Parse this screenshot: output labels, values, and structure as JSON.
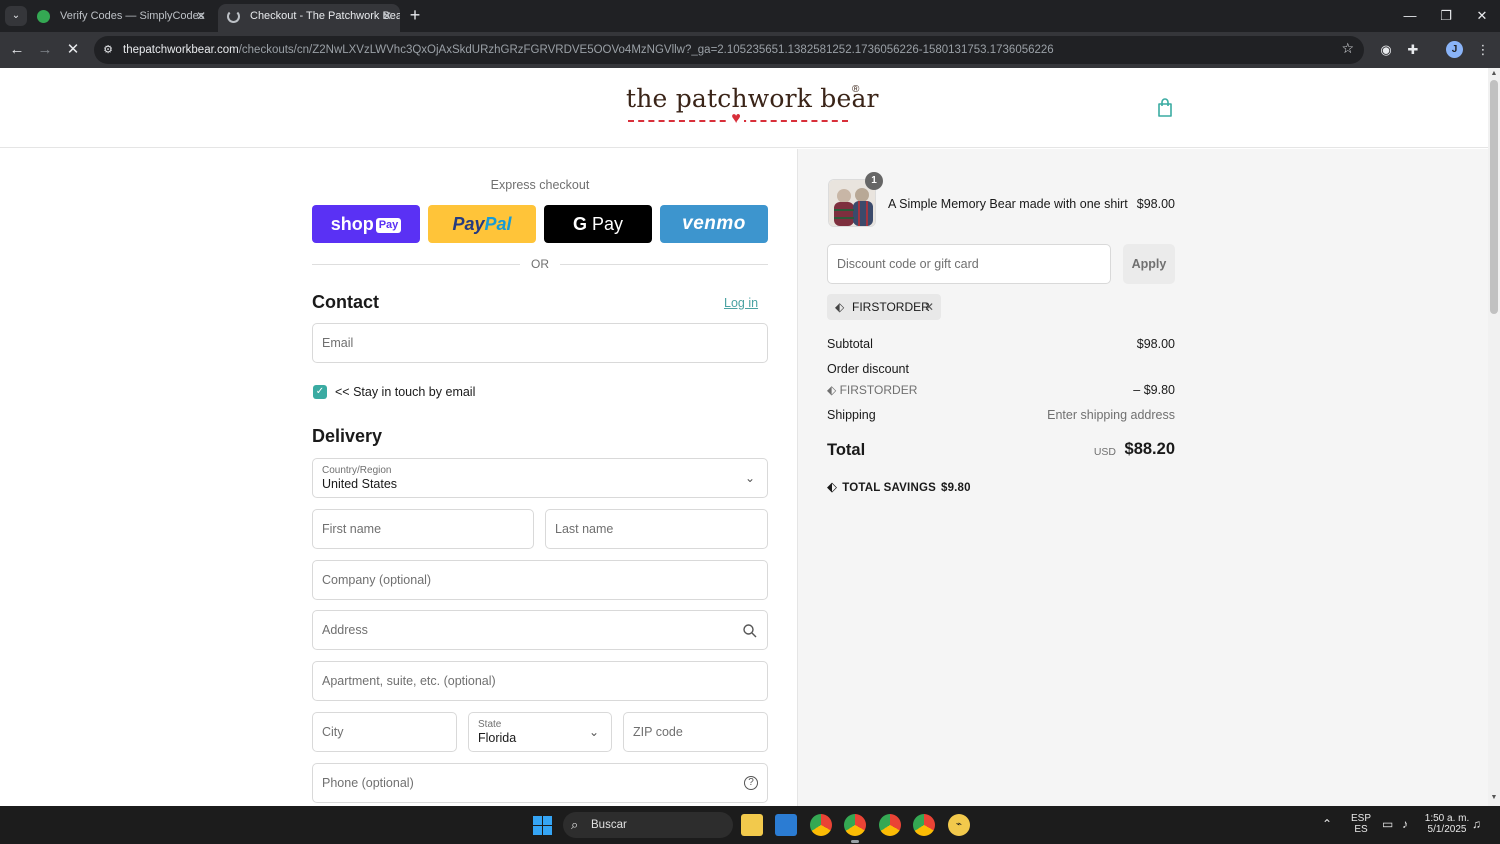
{
  "browser": {
    "tabs": [
      {
        "title": "Verify Codes — SimplyCodes",
        "active": false,
        "close": "✕"
      },
      {
        "title": "Checkout - The Patchwork Bear",
        "active": true,
        "close": "✕"
      }
    ],
    "new_tab": "+",
    "url_host": "thepatchworkbear.com",
    "url_path": "/checkouts/cn/Z2NwLXVzLWVhc3QxOjAxSkdURzhGRzFGRVRDVE5OOVo4MzNGVllw?_ga=2.105235651.1382581252.1736056226-1580131753.1736056226",
    "profile_initial": "J",
    "accent_color": "#35363a"
  },
  "store": {
    "logo_text": "the patchwork bear",
    "logo_mark": "®",
    "heart": "♥",
    "brand_color": "#3a2418",
    "heart_color": "#d82f3a"
  },
  "express": {
    "title": "Express checkout",
    "shop_label": "shop",
    "shop_sub": "Pay",
    "paypal_a": "Pay",
    "paypal_b": "Pal",
    "gpay_g": "G",
    "gpay_label": "Pay",
    "venmo_label": "venmo",
    "or_label": "OR"
  },
  "contact": {
    "heading": "Contact",
    "login_label": "Log in",
    "email_placeholder": "Email",
    "newsletter_checked": true,
    "newsletter_label": "<< Stay in touch by email",
    "check_mark": "✓"
  },
  "delivery": {
    "heading": "Delivery",
    "country_label": "Country/Region",
    "country_value": "United States",
    "first_name_placeholder": "First name",
    "last_name_placeholder": "Last name",
    "company_placeholder": "Company (optional)",
    "address_placeholder": "Address",
    "apartment_placeholder": "Apartment, suite, etc. (optional)",
    "city_placeholder": "City",
    "state_label": "State",
    "state_value": "Florida",
    "zip_placeholder": "ZIP code",
    "phone_placeholder": "Phone (optional)",
    "help_icon": "?"
  },
  "summary": {
    "item": {
      "name": "A Simple Memory Bear made with one shirt",
      "price": "$98.00",
      "quantity": "1"
    },
    "discount_placeholder": "Discount code or gift card",
    "apply_label": "Apply",
    "applied_code": "FIRSTORDER",
    "remove_mark": "✕",
    "subtotal_label": "Subtotal",
    "subtotal_value": "$98.00",
    "order_discount_label": "Order discount",
    "discount_code": "FIRSTORDER",
    "discount_value": "– $9.80",
    "shipping_label": "Shipping",
    "shipping_value": "Enter shipping address",
    "total_label": "Total",
    "total_currency": "USD",
    "total_value": "$88.20",
    "savings_label": "TOTAL SAVINGS",
    "savings_value": "$9.80"
  },
  "taskbar": {
    "search_label": "Buscar",
    "lang_top": "ESP",
    "lang_bottom": "ES",
    "time": "1:50 a. m.",
    "date": "5/1/2025",
    "badge_count": "1"
  }
}
